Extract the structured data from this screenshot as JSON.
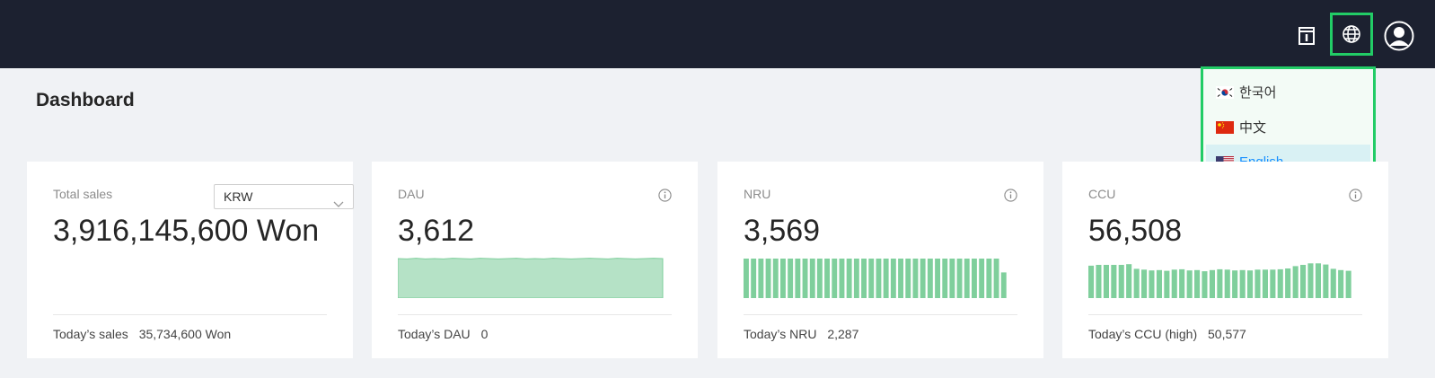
{
  "header": {
    "icons": [
      "document-icon",
      "globe-icon",
      "user-avatar-icon"
    ]
  },
  "language_menu": {
    "items": [
      {
        "label": "한국어",
        "flag": "korea-flag-icon",
        "active": false
      },
      {
        "label": "中文",
        "flag": "china-flag-icon",
        "active": false
      },
      {
        "label": "English",
        "flag": "usa-flag-icon",
        "active": true
      }
    ]
  },
  "page": {
    "title": "Dashboard"
  },
  "cards": {
    "sales": {
      "label": "Total sales",
      "currency_select": "KRW",
      "value": "3,916,145,600 Won",
      "foot_label": "Today’s sales",
      "foot_value": "35,734,600 Won"
    },
    "dau": {
      "label": "DAU",
      "value": "3,612",
      "foot_label": "Today’s DAU",
      "foot_value": "0"
    },
    "nru": {
      "label": "NRU",
      "value": "3,569",
      "foot_label": "Today’s NRU",
      "foot_value": "2,287"
    },
    "ccu": {
      "label": "CCU",
      "value": "56,508",
      "foot_label": "Today’s CCU (high)",
      "foot_value": "50,577"
    }
  },
  "colors": {
    "topbar": "#1c2130",
    "highlight": "#22cc66",
    "chart_fill": "#7fcf9c",
    "area_fill": "#b5e2c6",
    "active_link": "#1890ff"
  },
  "chart_data": [
    {
      "type": "area",
      "name": "DAU trend",
      "values": [
        100,
        99,
        101,
        99,
        100,
        99,
        101,
        100,
        99,
        101,
        100,
        99,
        100,
        101,
        99,
        100,
        99,
        101,
        100,
        99,
        100,
        101,
        100,
        99,
        101,
        100,
        99,
        100,
        101,
        100
      ],
      "ylim": [
        0,
        100
      ]
    },
    {
      "type": "bar",
      "name": "NRU trend",
      "values": [
        100,
        100,
        100,
        100,
        100,
        100,
        100,
        100,
        100,
        100,
        100,
        100,
        100,
        100,
        100,
        100,
        100,
        100,
        100,
        100,
        100,
        100,
        100,
        100,
        100,
        100,
        100,
        100,
        100,
        100,
        100,
        100,
        100,
        100,
        100,
        65
      ],
      "ylim": [
        0,
        100
      ]
    },
    {
      "type": "bar",
      "name": "CCU trend",
      "values": [
        82,
        84,
        84,
        84,
        84,
        86,
        74,
        72,
        70,
        71,
        69,
        72,
        73,
        70,
        71,
        68,
        71,
        73,
        72,
        70,
        71,
        70,
        72,
        72,
        72,
        73,
        75,
        81,
        84,
        88,
        88,
        85,
        74,
        71,
        69
      ],
      "ylim": [
        0,
        100
      ]
    }
  ]
}
